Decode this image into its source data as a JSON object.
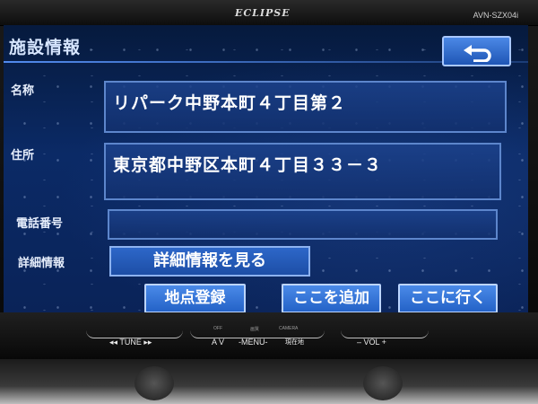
{
  "device": {
    "brand": "ECLIPSE",
    "model": "AVN-SZX04i"
  },
  "screen": {
    "title": "施設情報",
    "back_icon": "return-arrow-icon"
  },
  "fields": {
    "name_label": "名称",
    "name_value": "リパーク中野本町４丁目第２",
    "address_label": "住所",
    "address_value": "東京都中野区本町４丁目３３－３",
    "phone_label": "電話番号",
    "phone_value": "",
    "detail_label": "詳細情報",
    "detail_button": "詳細情報を見る"
  },
  "actions": {
    "register": "地点登録",
    "add_here": "ここを追加",
    "go_here": "ここに行く"
  },
  "controls": {
    "tune": "◂◂ TUNE ▸▸",
    "av": "A V",
    "menu": "-MENU-",
    "current": "現在地",
    "vol": "– VOL +",
    "off": "OFF",
    "camera": "CAMERA",
    "display": "画質"
  },
  "colors": {
    "screen_bg": "#0b2a66",
    "button_blue": "#2f6fd6",
    "field_border": "#5d86cc"
  }
}
